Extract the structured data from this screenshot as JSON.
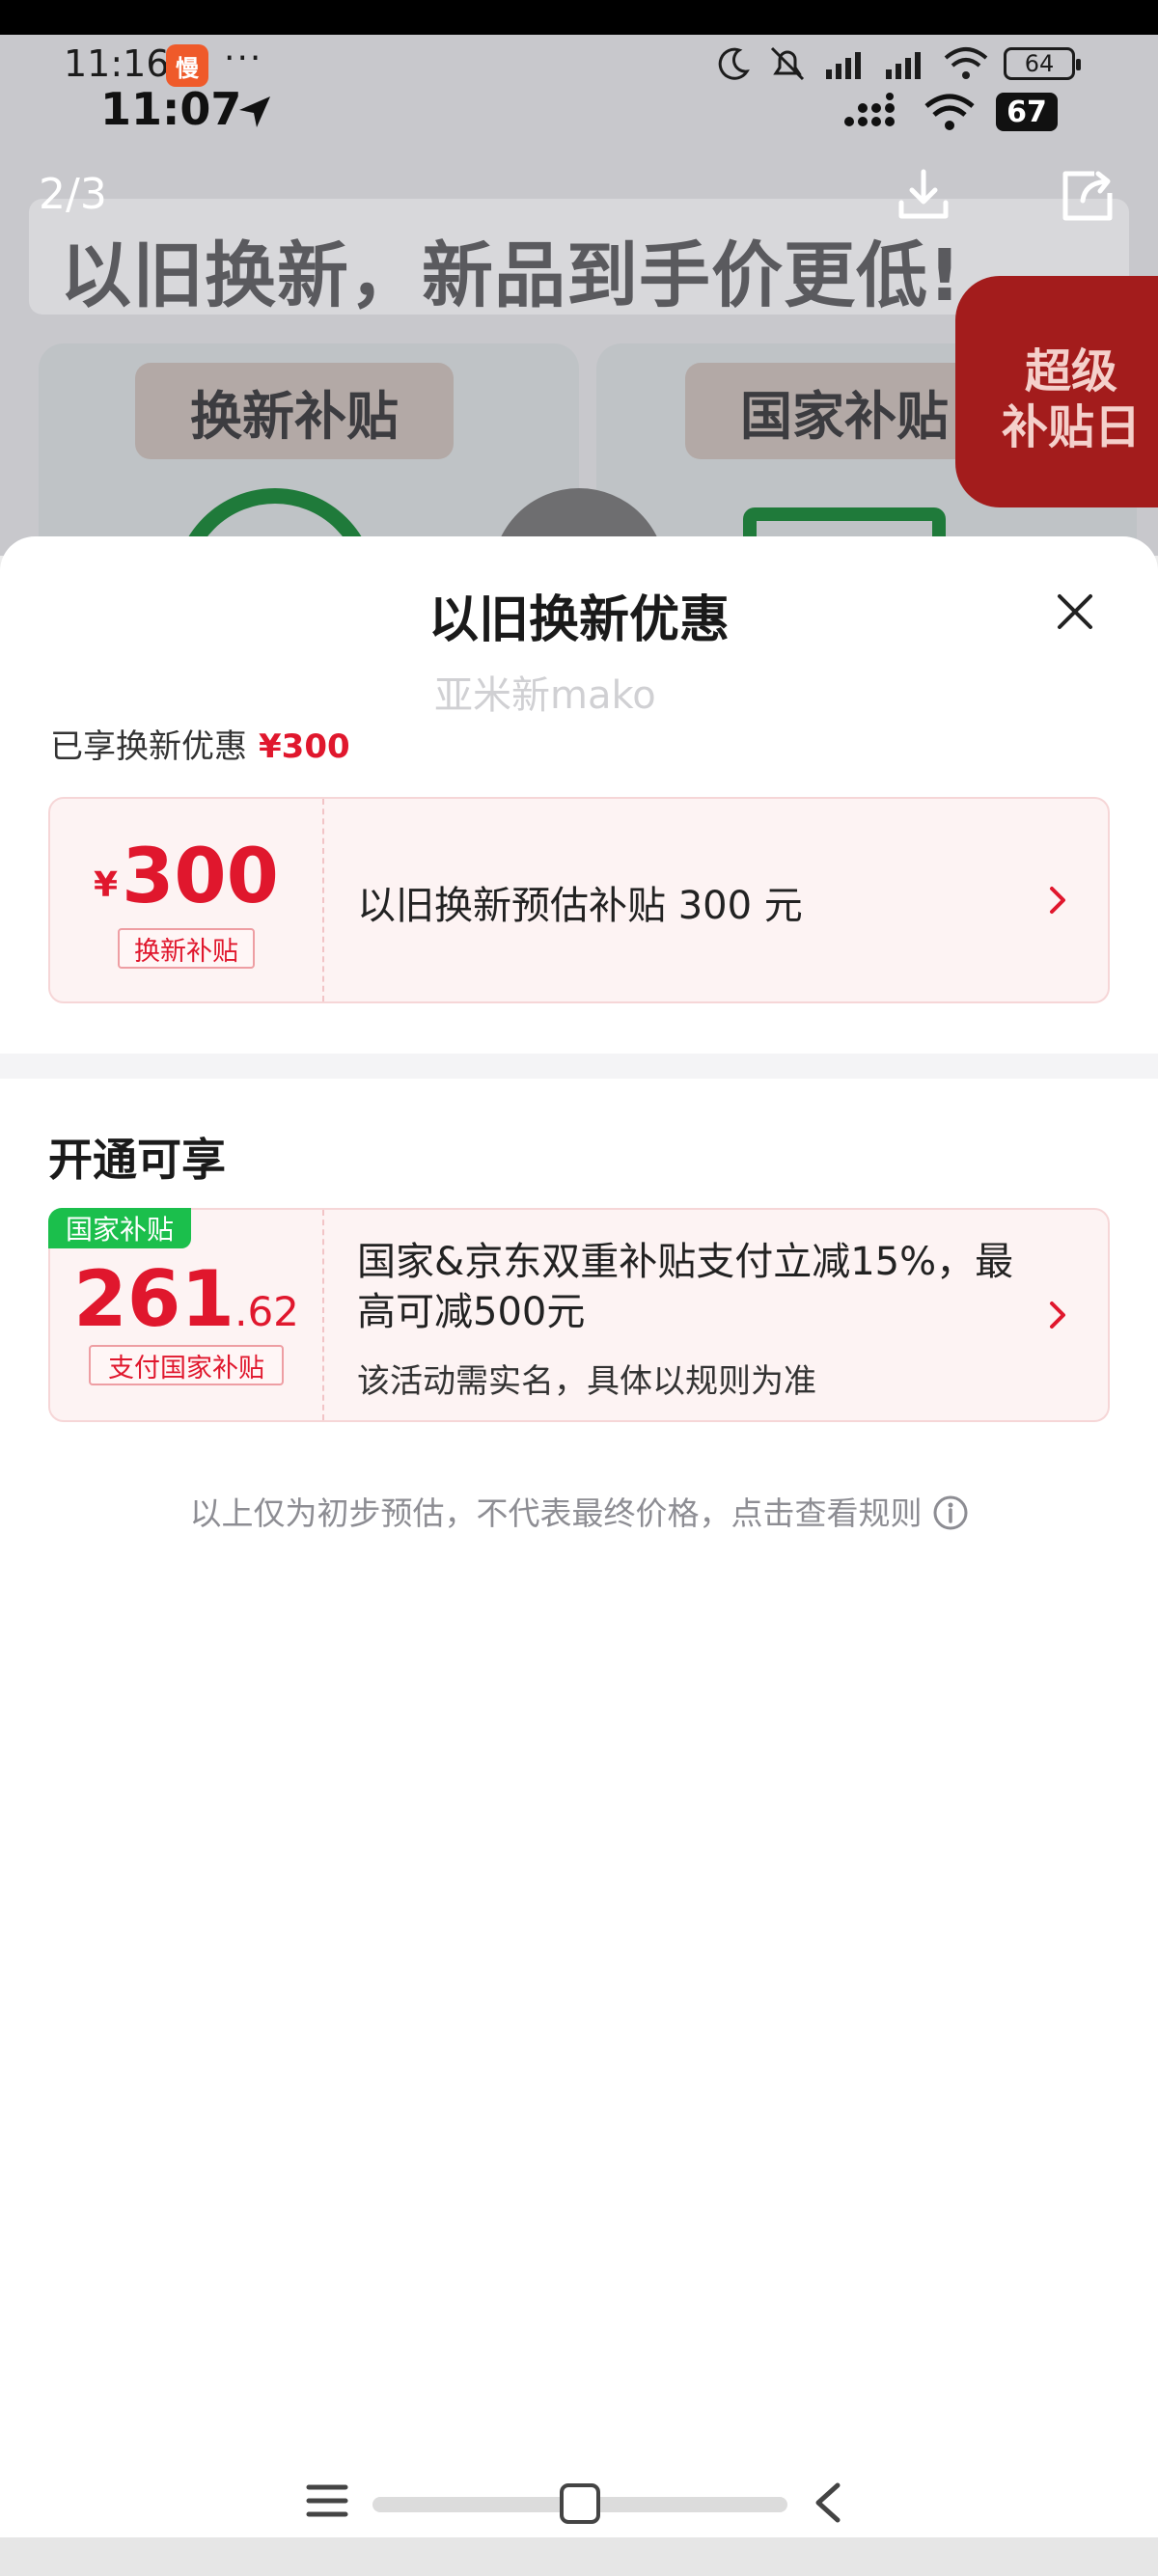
{
  "status_bar": {
    "time_primary": "11:16",
    "app_badge": "慢",
    "more": "···",
    "time_secondary": "11:07",
    "battery_primary": "64",
    "battery_secondary": "67"
  },
  "viewer": {
    "page_counter": "2/3"
  },
  "background_page": {
    "headline": "以旧换新，新品到手价更低!",
    "tab_trade_in": "换新补贴",
    "tab_national": "国家补贴",
    "badge_line1": "超级",
    "badge_line2": "补贴日"
  },
  "sheet": {
    "title": "以旧换新优惠",
    "enjoyed_label": "已享换新优惠",
    "enjoyed_amount": "¥300",
    "coupon1": {
      "currency": "¥",
      "amount": "300",
      "tag": "换新补贴",
      "description": "以旧换新预估补贴 300 元"
    },
    "section_title": "开通可享",
    "coupon2": {
      "ribbon": "国家补贴",
      "amount_int": "261",
      "amount_dec": ".62",
      "tag": "支付国家补贴",
      "description": "国家&京东双重补贴支付立减15%，最高可减500元",
      "note": "该活动需实名，具体以规则为准"
    },
    "disclaimer": "以上仅为初步预估，不代表最终价格，点击查看规则"
  },
  "watermark": "亚米新mako",
  "colors": {
    "accent_red": "#e0172d",
    "ribbon_green": "#1bbf4c",
    "coupon_bg": "#fdf3f3"
  }
}
